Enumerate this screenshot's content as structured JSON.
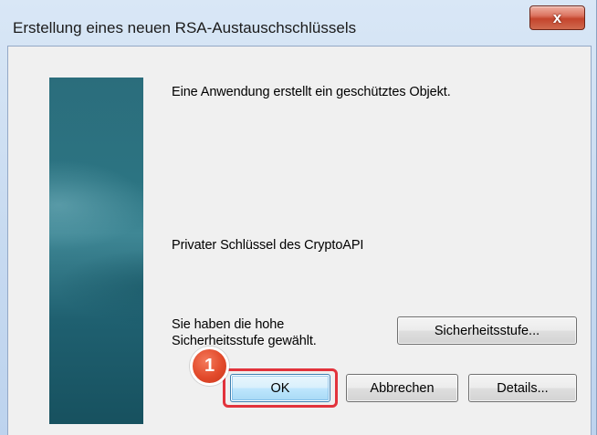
{
  "window": {
    "title": "Erstellung eines neuen RSA-Austauschschlüssels",
    "close_glyph": "x"
  },
  "dialog": {
    "message": "Eine Anwendung erstellt ein geschütztes Objekt.",
    "object_name": "Privater Schlüssel des CryptoAPI",
    "security_status_line1": "Sie haben die hohe",
    "security_status_line2": "Sicherheitsstufe gewählt.",
    "security_level_button": "Sicherheitsstufe...",
    "ok_button": "OK",
    "cancel_button": "Abbrechen",
    "details_button": "Details..."
  },
  "annotation": {
    "step_number": "1",
    "highlight_color": "#e2333c"
  },
  "colors": {
    "banner": "#2c7482",
    "close_button": "#c4452d",
    "default_button_border": "#3c7fb1"
  },
  "icons": {
    "close": "close-icon",
    "banner": "side-banner"
  }
}
